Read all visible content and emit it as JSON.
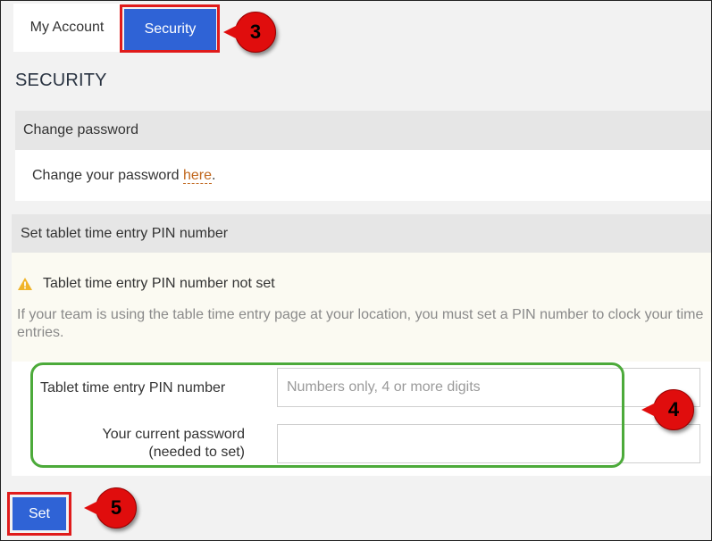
{
  "tabs": [
    {
      "label": "My Account"
    },
    {
      "label": "Security"
    }
  ],
  "page": {
    "title": "SECURITY"
  },
  "change_password": {
    "header": "Change password",
    "text_before": "Change your password ",
    "link_text": "here",
    "text_after": "."
  },
  "pin": {
    "header": "Set tablet time entry PIN number",
    "warning_title": "Tablet time entry PIN number not set",
    "warning_text": "If your team is using the table time entry page at your location, you must set a PIN number to clock your time entries.",
    "pin_label": "Tablet time entry PIN number",
    "pin_placeholder": "Numbers only, 4 or more digits",
    "pin_value": "",
    "password_label_line1": "Your current password",
    "password_label_line2": "(needed to set)",
    "password_value": "",
    "set_label": "Set"
  },
  "callouts": {
    "security_tab": "3",
    "form": "4",
    "set_button": "5"
  },
  "colors": {
    "accent_blue": "#2f63d6",
    "callout_red": "#e00d0d",
    "highlight_green": "#4caa3a",
    "link_orange": "#c0661c",
    "warning_yellow": "#f0b429"
  },
  "icons": {
    "warning": "warning-triangle-icon"
  }
}
